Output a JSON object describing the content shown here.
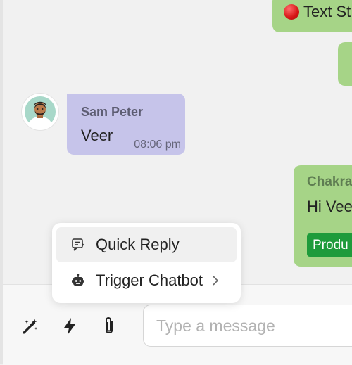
{
  "messages": {
    "outgoing_top": {
      "text": "Text St"
    },
    "incoming": {
      "sender": "Sam Peter",
      "text": "Veer",
      "time": "08:06 pm"
    },
    "outgoing_bottom": {
      "sender": "Chakra",
      "text": "Hi Vee",
      "tag": "Produ"
    }
  },
  "popup_menu": {
    "items": [
      {
        "label": "Quick Reply",
        "icon": "quick-reply-icon"
      },
      {
        "label": "Trigger Chatbot",
        "icon": "robot-icon"
      }
    ]
  },
  "composer": {
    "placeholder": "Type a message",
    "tools": [
      "magic-wand-icon",
      "lightning-icon",
      "paperclip-icon"
    ]
  },
  "colors": {
    "outgoing_bubble": "#a6d487",
    "incoming_bubble": "#c6c4ea",
    "tag": "#1e9b3b",
    "background": "#f1f1f1"
  }
}
